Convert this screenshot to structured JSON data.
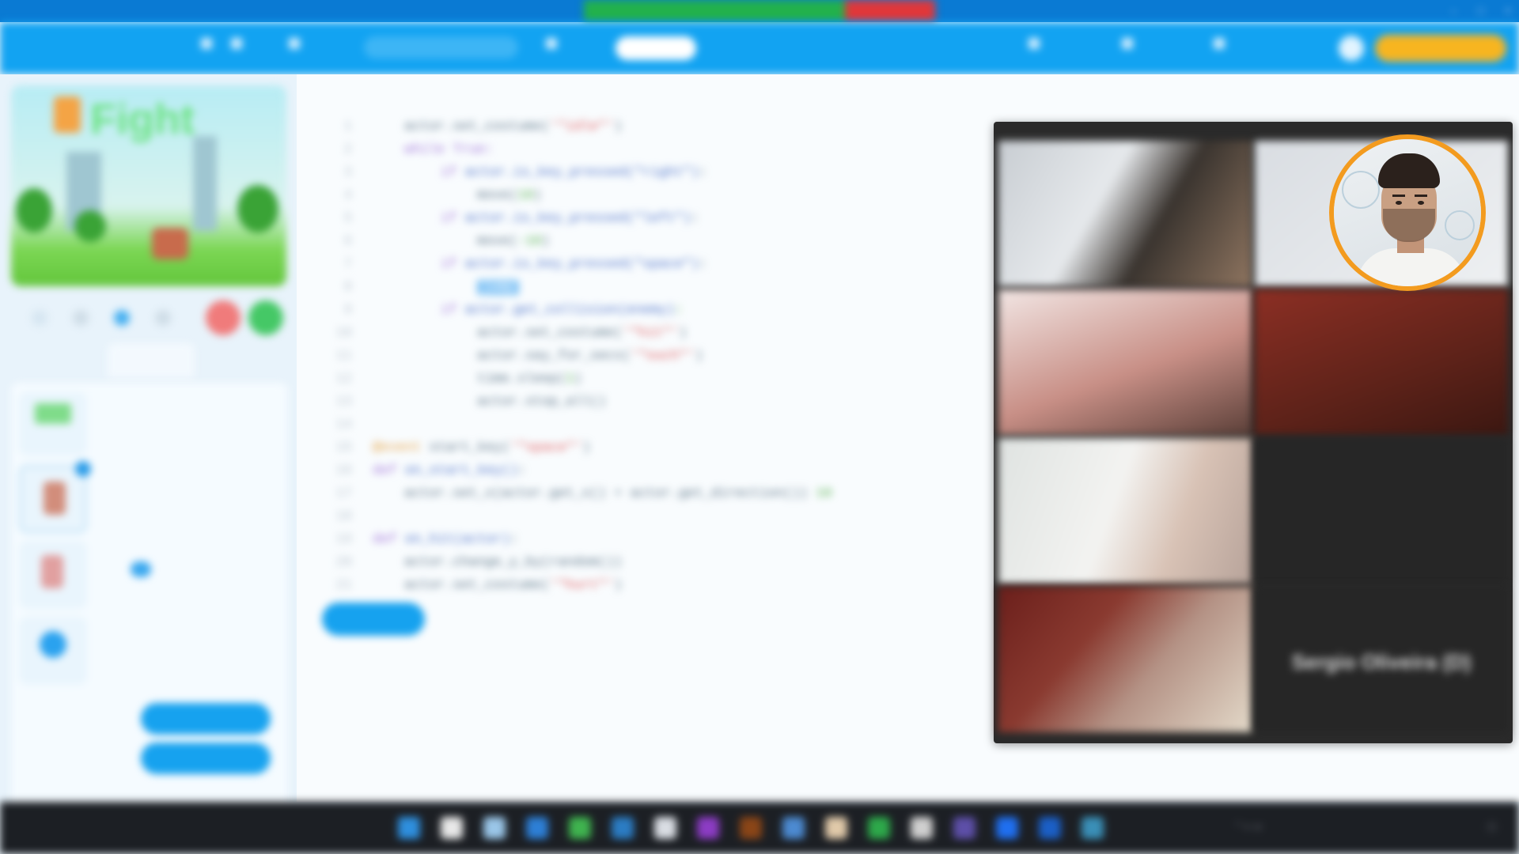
{
  "window": {
    "title": ""
  },
  "meeting_bar": {
    "share_text": "",
    "stop_label": ""
  },
  "toolbar": {
    "project_name": "",
    "menu_file": "",
    "menu_edit": "",
    "menu_help": "",
    "search_placeholder": "",
    "view_label": "",
    "active_pill": "",
    "mode_label": "",
    "action1": "",
    "action2": "",
    "action3": "",
    "upgrade_label": ""
  },
  "left_panel": {
    "stage_title": "Fight",
    "tabs": [
      "",
      "",
      ""
    ],
    "sprite_names": [
      "",
      "",
      "",
      ""
    ],
    "props": {
      "name_label": "",
      "name_value": "",
      "x_label": "",
      "x_value": "",
      "y_label": "",
      "y_value": "",
      "size_label": "",
      "size_value": "",
      "direction_label": "",
      "direction_value": "",
      "show_label": ""
    },
    "btn_add": "",
    "btn_upload": ""
  },
  "editor": {
    "run_label": "",
    "top_right_1": "",
    "top_right_2": ""
  },
  "video": {
    "tiles": [
      {
        "label": ""
      },
      {
        "label": ""
      },
      {
        "label": ""
      },
      {
        "label": ""
      },
      {
        "label": ""
      },
      {
        "label": ""
      },
      {
        "label": ""
      },
      {
        "label": "",
        "big_name": "Sergio Oliveira (D)"
      }
    ]
  },
  "taskbar": {
    "time": "",
    "date": ""
  },
  "colors": {
    "brand_blue": "#12a3f2",
    "meeting_green": "#22b14c",
    "meeting_red": "#e0373a",
    "accent_gold": "#f7b520",
    "cam_ring": "#f39b1f"
  }
}
